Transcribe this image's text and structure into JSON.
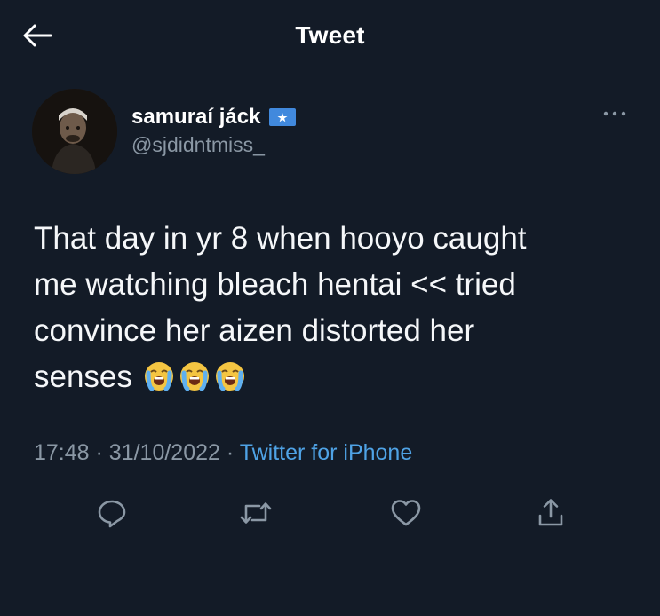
{
  "header": {
    "title": "Tweet",
    "back_icon": "arrow-left-icon"
  },
  "author": {
    "display_name": "samuraí jáck",
    "handle": "@sjdidntmiss_",
    "flag_icon": "somalia-flag-icon",
    "more_icon": "more-horizontal-icon"
  },
  "tweet": {
    "text": "That day in yr 8 when hooyo caught\nme watching bleach hentai << tried\nconvince her aizen distorted her\nsenses",
    "emojis": [
      "loudly-crying-face-emoji",
      "loudly-crying-face-emoji",
      "loudly-crying-face-emoji"
    ]
  },
  "meta": {
    "time": "17:48",
    "separator": "·",
    "date": "31/10/2022",
    "source": "Twitter for iPhone"
  },
  "actions": {
    "reply_icon": "reply-icon",
    "retweet_icon": "retweet-icon",
    "like_icon": "heart-icon",
    "share_icon": "share-icon"
  },
  "colors": {
    "background": "#131b27",
    "text": "#ffffff",
    "secondary_text": "#8b98a5",
    "link": "#4fa3e6",
    "flag_blue": "#4189dd"
  }
}
